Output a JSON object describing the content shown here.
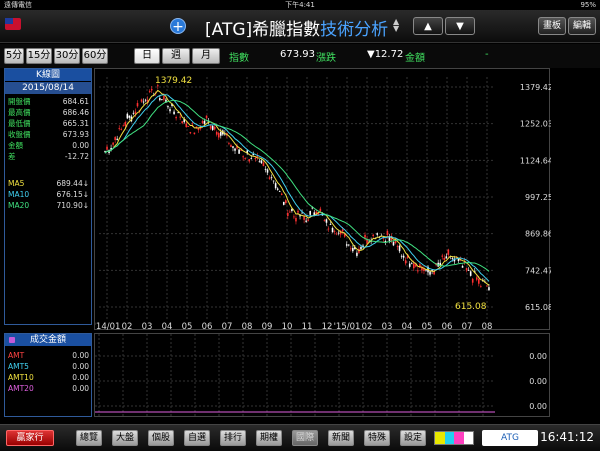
{
  "statusbar": {
    "carrier": "遠傳電信",
    "time": "下午4:41",
    "battery": "95%"
  },
  "header": {
    "title_prefix": "[ATG]希臘指數",
    "title_accent": "技術分析",
    "updown_symbol": "▲\n▼",
    "prev_label": "▲",
    "next_label": "▼",
    "board_label": "畫板",
    "edit_label": "編輯",
    "page_dots": "● ● ● ● ●",
    "plus_label": "+"
  },
  "periods": [
    {
      "label": "5分",
      "selected": false
    },
    {
      "label": "15分",
      "selected": false
    },
    {
      "label": "30分",
      "selected": false
    },
    {
      "label": "60分",
      "selected": false
    },
    {
      "label": "日",
      "selected": true
    },
    {
      "label": "週",
      "selected": false
    },
    {
      "label": "月",
      "selected": false
    }
  ],
  "quote": {
    "index_label": "指數",
    "index_value": "673.93",
    "change_label": "漲跌",
    "change_value": "▼12.72",
    "amount_label": "金額",
    "amount_value": "-"
  },
  "kpanel": {
    "header": "K線圖",
    "date": "2015/08/14",
    "rows": [
      {
        "k": "開盤價",
        "v": "684.61"
      },
      {
        "k": "最高價",
        "v": "686.46"
      },
      {
        "k": "最低價",
        "v": "665.31"
      },
      {
        "k": "收盤價",
        "v": "673.93"
      },
      {
        "k": "金額",
        "v": "0.00"
      },
      {
        "k": "差",
        "v": "-12.72"
      }
    ],
    "ma": [
      {
        "k": "MA5",
        "v": "689.44↓",
        "color": "#f0e040"
      },
      {
        "k": "MA10",
        "v": "676.15↓",
        "color": "#40d0f0"
      },
      {
        "k": "MA20",
        "v": "710.90↓",
        "color": "#40e080"
      }
    ]
  },
  "volpanel": {
    "header": "成交金額",
    "rows": [
      {
        "k": "AMT",
        "v": "0.00",
        "color": "#ff4444"
      },
      {
        "k": "AMT5",
        "v": "0.00",
        "color": "#40d0f0"
      },
      {
        "k": "AMT10",
        "v": "0.00",
        "color": "#f0e040"
      },
      {
        "k": "AMT20",
        "v": "0.00",
        "color": "#e060e0"
      }
    ],
    "axis": [
      "0.00",
      "0.00",
      "0.00"
    ]
  },
  "chart_data": {
    "type": "line",
    "title": "",
    "y_ticks": [
      "1379.42",
      "1252.03",
      "1124.64",
      "997.25",
      "869.86",
      "742.47",
      "615.08"
    ],
    "ylim": [
      615.08,
      1379.42
    ],
    "x_ticks": [
      "'14/01",
      "02",
      "03",
      "04",
      "05",
      "06",
      "07",
      "08",
      "09",
      "10",
      "11",
      "12",
      "'15/01",
      "02",
      "03",
      "04",
      "05",
      "06",
      "07",
      "08"
    ],
    "annotations": {
      "high": "1379.42",
      "low": "615.08"
    },
    "grid": true,
    "series": [
      {
        "values": [
          1150,
          1200,
          1260,
          1300,
          1340,
          1370,
          1330,
          1290,
          1250,
          1230,
          1265,
          1240,
          1200,
          1160,
          1150,
          1120,
          1090,
          1040,
          960,
          930,
          920,
          960,
          900,
          890,
          840,
          810,
          860,
          870,
          860,
          820,
          780,
          760,
          730,
          760,
          790,
          770,
          740,
          700,
          680
        ]
      }
    ],
    "series_colors": [
      "#ffffff",
      "#f0e040",
      "#40d0f0",
      "#40e080"
    ],
    "candle_colors": {
      "up": "#ff3030",
      "down": "#ffffff"
    }
  },
  "bottombar": {
    "brand": "贏家行",
    "tabs": [
      {
        "label": "總覽",
        "active": false
      },
      {
        "label": "大盤",
        "active": false
      },
      {
        "label": "個股",
        "active": false
      },
      {
        "label": "自選",
        "active": false
      },
      {
        "label": "排行",
        "active": false
      },
      {
        "label": "期權",
        "active": false
      },
      {
        "label": "國際",
        "active": true
      },
      {
        "label": "新聞",
        "active": false
      },
      {
        "label": "特殊",
        "active": false
      },
      {
        "label": "設定",
        "active": false
      }
    ],
    "symbol": "ATG",
    "clock": "16:41:12",
    "palette": [
      "#e8e800",
      "#20d0f0",
      "#ff40c0",
      "#ffffff"
    ]
  }
}
